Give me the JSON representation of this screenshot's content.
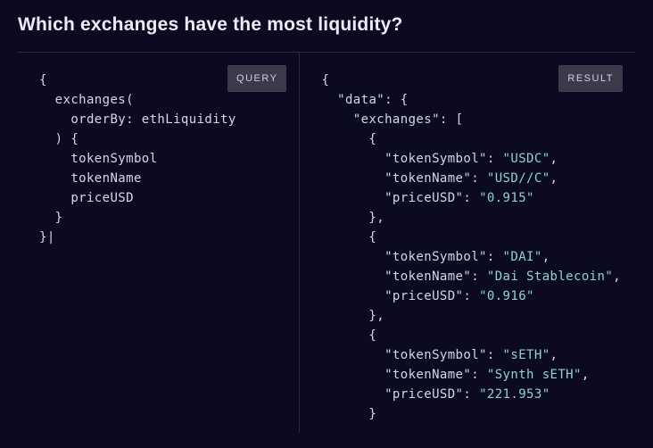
{
  "title": "Which exchanges have the most liquidity?",
  "badges": {
    "query": "QUERY",
    "result": "RESULT"
  },
  "query": {
    "root": "exchanges",
    "orderByKey": "orderBy",
    "orderByVal": "ethLiquidity",
    "fields": [
      "tokenSymbol",
      "tokenName",
      "priceUSD"
    ]
  },
  "result": {
    "dataKey": "data",
    "exchangesKey": "exchanges",
    "keys": {
      "tokenSymbol": "tokenSymbol",
      "tokenName": "tokenName",
      "priceUSD": "priceUSD"
    },
    "items": [
      {
        "tokenSymbol": "USDC",
        "tokenName": "USD//C",
        "priceUSD": "0.915"
      },
      {
        "tokenSymbol": "DAI",
        "tokenName": "Dai Stablecoin",
        "priceUSD": "0.916"
      },
      {
        "tokenSymbol": "sETH",
        "tokenName": "Synth sETH",
        "priceUSD": "221.953"
      }
    ]
  }
}
